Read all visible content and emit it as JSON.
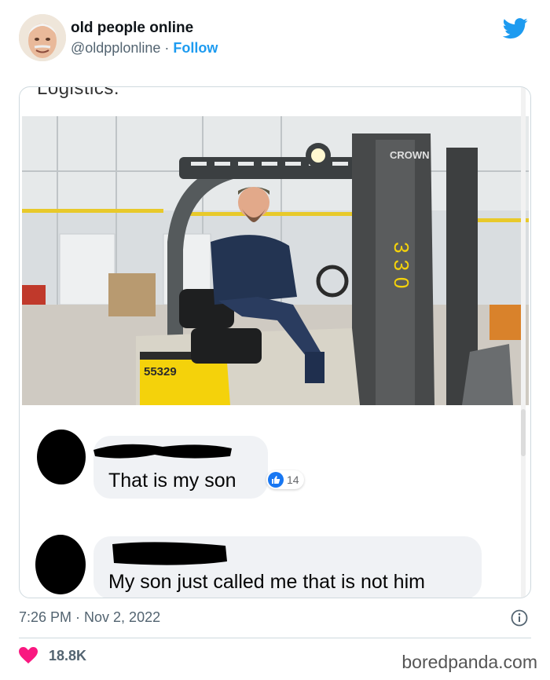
{
  "tweet": {
    "display_name": "old people online",
    "handle": "@oldpplonline",
    "separator": "·",
    "follow_label": "Follow",
    "embedded": {
      "caption_top": "Logistics.",
      "photo": {
        "forklift_brand": "CROWN",
        "mast_number": "330",
        "plate": "55329"
      },
      "comments": [
        {
          "text": "That is my son",
          "likes": "14"
        },
        {
          "text": "My son just called me that is not him"
        }
      ]
    },
    "timestamp": "7:26 PM · Nov 2, 2022",
    "likes_count": "18.8K",
    "watermark": "boredpanda.com"
  },
  "colors": {
    "twitter_blue": "#1d9bf0",
    "heart_pink": "#f91880",
    "secondary_text": "#536471",
    "bubble_bg": "#f0f2f5",
    "fb_like_blue": "#1877f2",
    "forklift_yellow": "#f4d20b"
  },
  "icons": [
    "twitter-bird-icon",
    "info-icon",
    "heart-icon",
    "thumbs-up-icon"
  ]
}
